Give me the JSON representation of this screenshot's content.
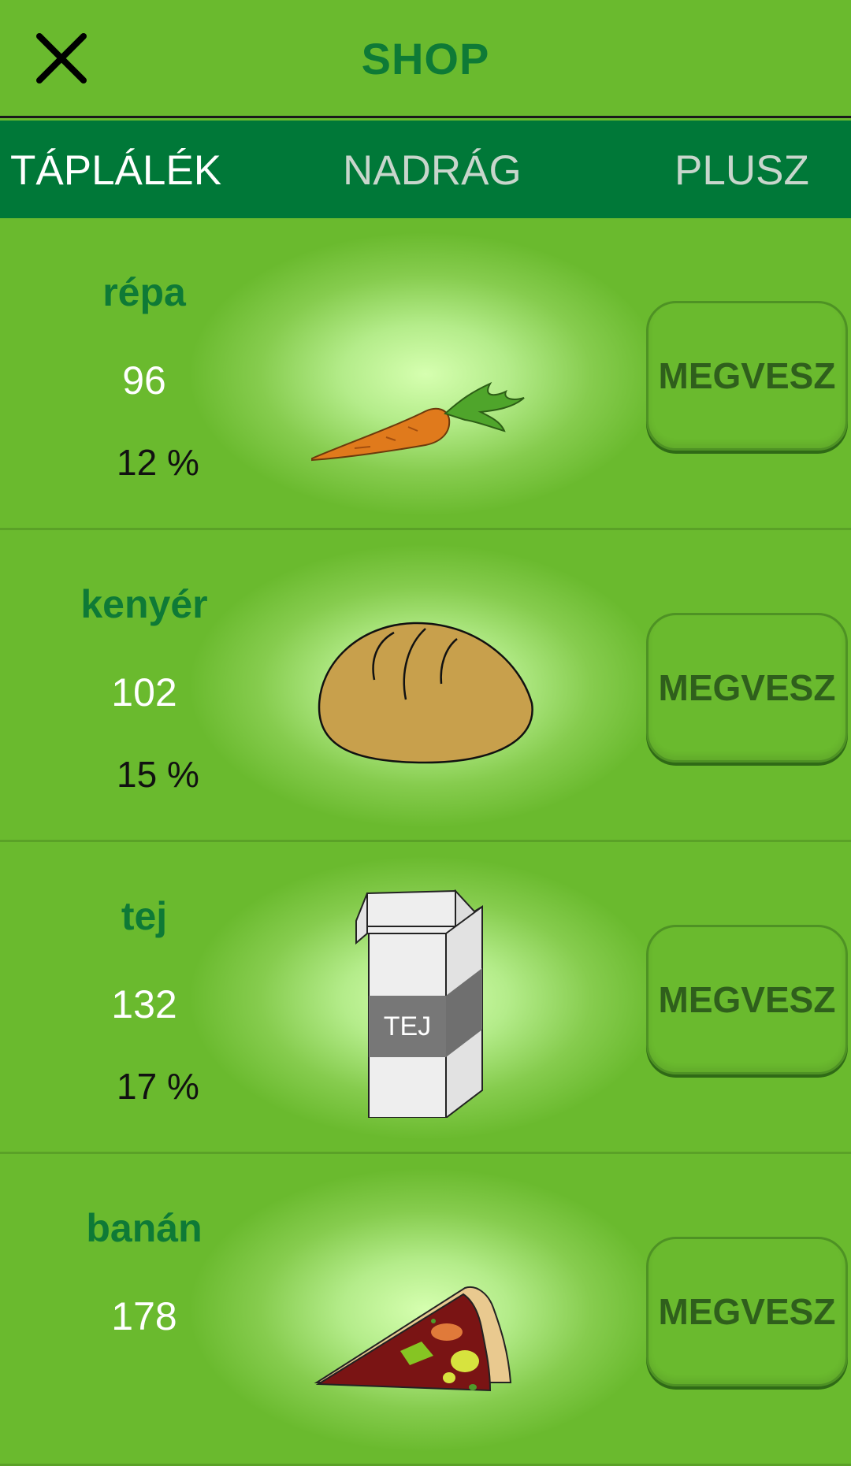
{
  "header": {
    "title": "SHOP"
  },
  "tabs": [
    {
      "label": "TÁPLÁLÉK",
      "active": true
    },
    {
      "label": "NADRÁG",
      "active": false
    },
    {
      "label": "PLUSZ",
      "active": false
    }
  ],
  "items": [
    {
      "name": "répa",
      "price": "96",
      "percent": "12 %",
      "button": "MEGVESZ",
      "icon": "carrot-icon"
    },
    {
      "name": "kenyér",
      "price": "102",
      "percent": "15 %",
      "button": "MEGVESZ",
      "icon": "bread-icon"
    },
    {
      "name": "tej",
      "price": "132",
      "percent": "17 %",
      "button": "MEGVESZ",
      "icon": "milk-carton-icon",
      "icon_label": "TEJ"
    },
    {
      "name": "banán",
      "price": "178",
      "percent": "",
      "button": "MEGVESZ",
      "icon": "pizza-slice-icon"
    }
  ],
  "colors": {
    "background": "#6aba2e",
    "tab_bar": "#007838",
    "title": "#0e7a36"
  }
}
